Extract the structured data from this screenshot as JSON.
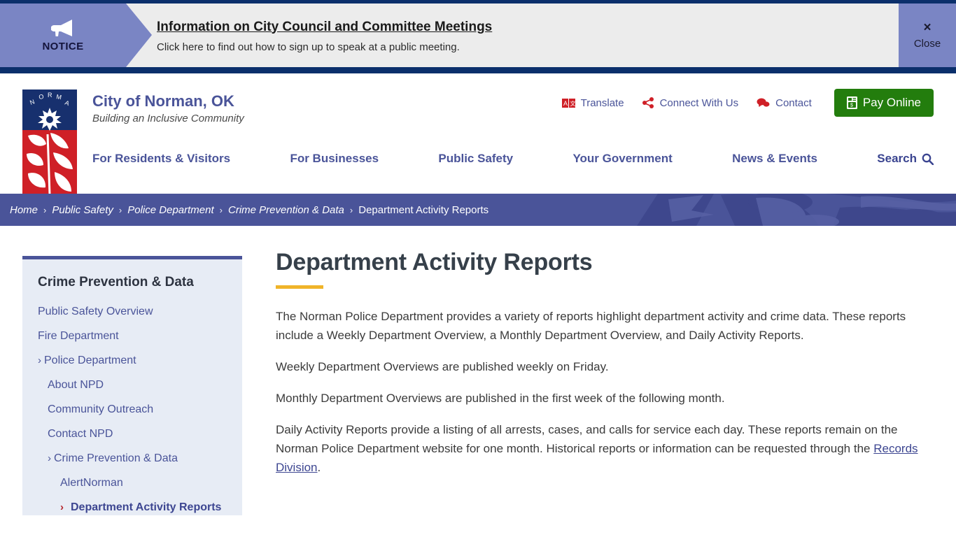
{
  "notice": {
    "flag_label": "NOTICE",
    "icon": "megaphone-icon",
    "title": "Information on City Council and Committee Meetings",
    "subtitle": "Click here to find out how to sign up to speak at a public meeting.",
    "close_glyph": "×",
    "close_label": "Close",
    "flag_color": "#7a85c4",
    "background": "#ececec",
    "rule_color": "#0b2f6b"
  },
  "header": {
    "logo_alt": "City of Norman seal",
    "brand_title": "City of Norman, OK",
    "brand_tagline": "Building an Inclusive Community",
    "utility": [
      {
        "label": "Translate",
        "icon": "translate-icon"
      },
      {
        "label": "Connect With Us",
        "icon": "share-icon"
      },
      {
        "label": "Contact",
        "icon": "speech-bubble-icon"
      }
    ],
    "pay_button": {
      "label": "Pay Online",
      "icon": "invoice-icon",
      "color": "#237d0d"
    },
    "nav": [
      "For Residents & Visitors",
      "For Businesses",
      "Public Safety",
      "Your Government",
      "News & Events"
    ],
    "search": {
      "label": "Search",
      "icon": "magnifier-icon"
    },
    "accent_color": "#4a5499"
  },
  "breadcrumb": {
    "separator": "›",
    "items": [
      {
        "label": "Home",
        "current": false
      },
      {
        "label": "Public Safety",
        "current": false
      },
      {
        "label": "Police Department",
        "current": false
      },
      {
        "label": "Crime Prevention & Data",
        "current": false
      },
      {
        "label": "Department Activity Reports",
        "current": true
      }
    ],
    "background": "#4a5499"
  },
  "sidebar": {
    "title": "Crime Prevention & Data",
    "items": [
      {
        "label": "Public Safety Overview",
        "level": 1,
        "chevron": false,
        "active": false
      },
      {
        "label": "Fire Department",
        "level": 1,
        "chevron": false,
        "active": false
      },
      {
        "label": "Police Department",
        "level": 1,
        "chevron": true,
        "active": false
      },
      {
        "label": "About NPD",
        "level": 2,
        "chevron": false,
        "active": false
      },
      {
        "label": "Community Outreach",
        "level": 2,
        "chevron": false,
        "active": false
      },
      {
        "label": "Contact NPD",
        "level": 2,
        "chevron": false,
        "active": false
      },
      {
        "label": "Crime Prevention & Data",
        "level": 2,
        "chevron": true,
        "active": false
      },
      {
        "label": "AlertNorman",
        "level": 3,
        "chevron": false,
        "active": false
      },
      {
        "label": "Department Activity Reports",
        "level": 3,
        "chevron": true,
        "active": true
      }
    ],
    "chevron_glyph": "›",
    "background": "#e7ecf5",
    "top_border_color": "#4a5499"
  },
  "main": {
    "title": "Department Activity Reports",
    "accent_rule_color": "#f0b429",
    "paragraphs": [
      "The Norman Police Department provides a variety of reports highlight department activity and crime data. These reports include a Weekly Department Overview, a Monthly Department Overview, and Daily Activity Reports.",
      "Weekly Department Overviews are published weekly on Friday.",
      "Monthly Department Overviews are published in the first week of the following month."
    ],
    "last_paragraph": {
      "before_link": "Daily Activity Reports provide a listing of all arrests, cases, and calls for service each day. These reports remain on the Norman Police Department website for one month. Historical reports or information can be requested through the ",
      "link_label": "Records Division",
      "after_link": "."
    }
  }
}
